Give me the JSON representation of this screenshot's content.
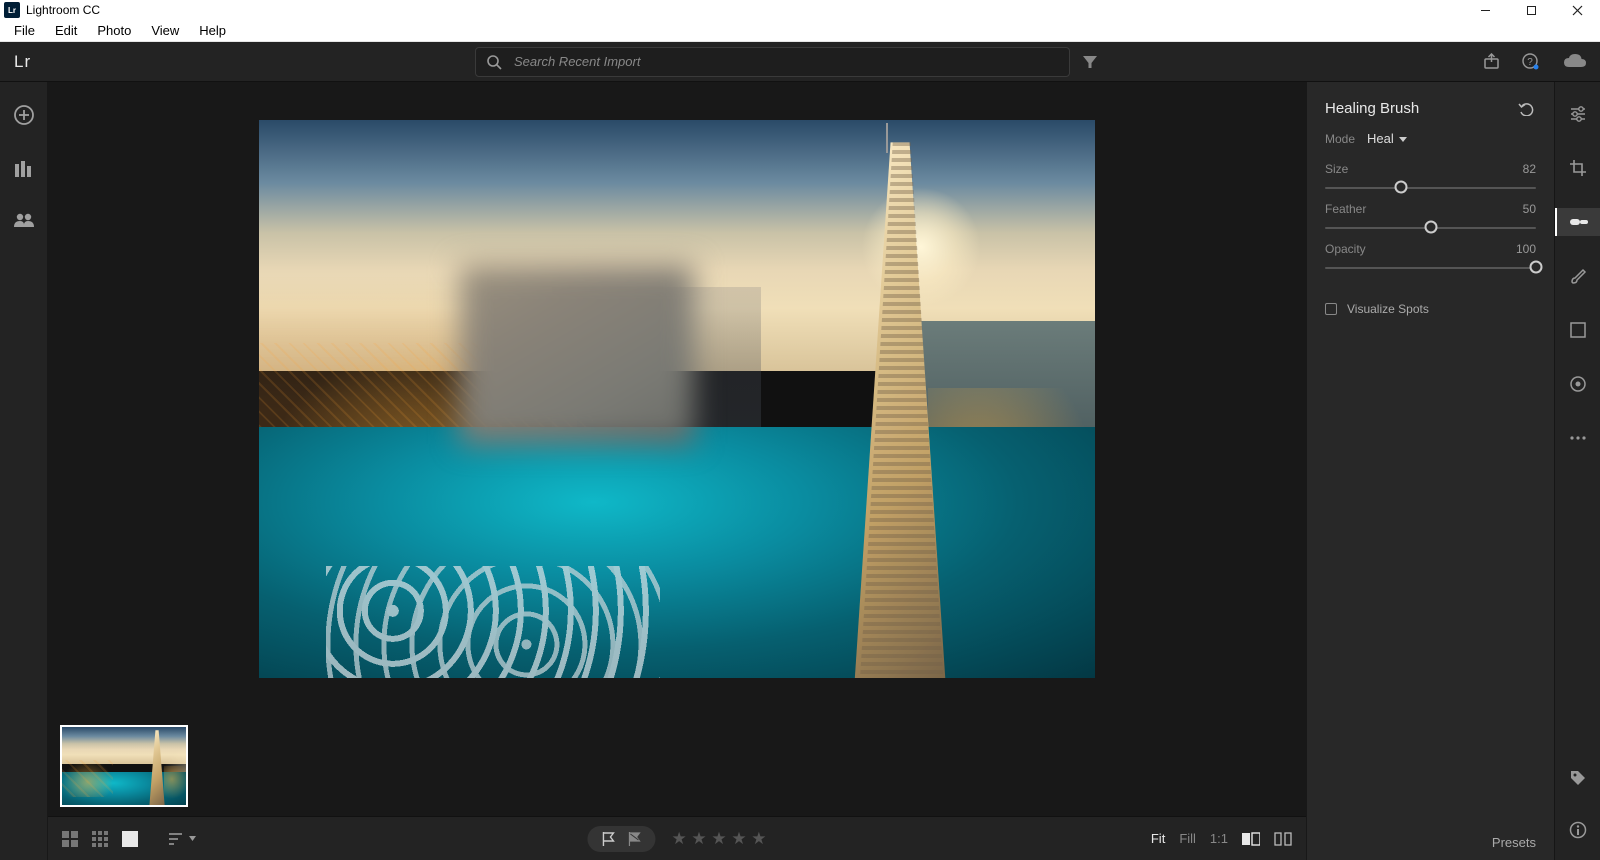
{
  "window": {
    "title": "Lightroom CC",
    "logo": "Lr"
  },
  "menubar": [
    "File",
    "Edit",
    "Photo",
    "View",
    "Help"
  ],
  "header": {
    "search_placeholder": "Search Recent Import",
    "logo": "Lr"
  },
  "panel": {
    "title": "Healing Brush",
    "mode_label": "Mode",
    "mode_value": "Heal",
    "sliders": [
      {
        "label": "Size",
        "value": 82,
        "pos": 36
      },
      {
        "label": "Feather",
        "value": 50,
        "pos": 50
      },
      {
        "label": "Opacity",
        "value": 100,
        "pos": 100
      }
    ],
    "visualize_label": "Visualize Spots"
  },
  "bottombar": {
    "zoom": [
      "Fit",
      "Fill",
      "1:1"
    ],
    "zoom_active": "Fit",
    "presets_label": "Presets"
  }
}
